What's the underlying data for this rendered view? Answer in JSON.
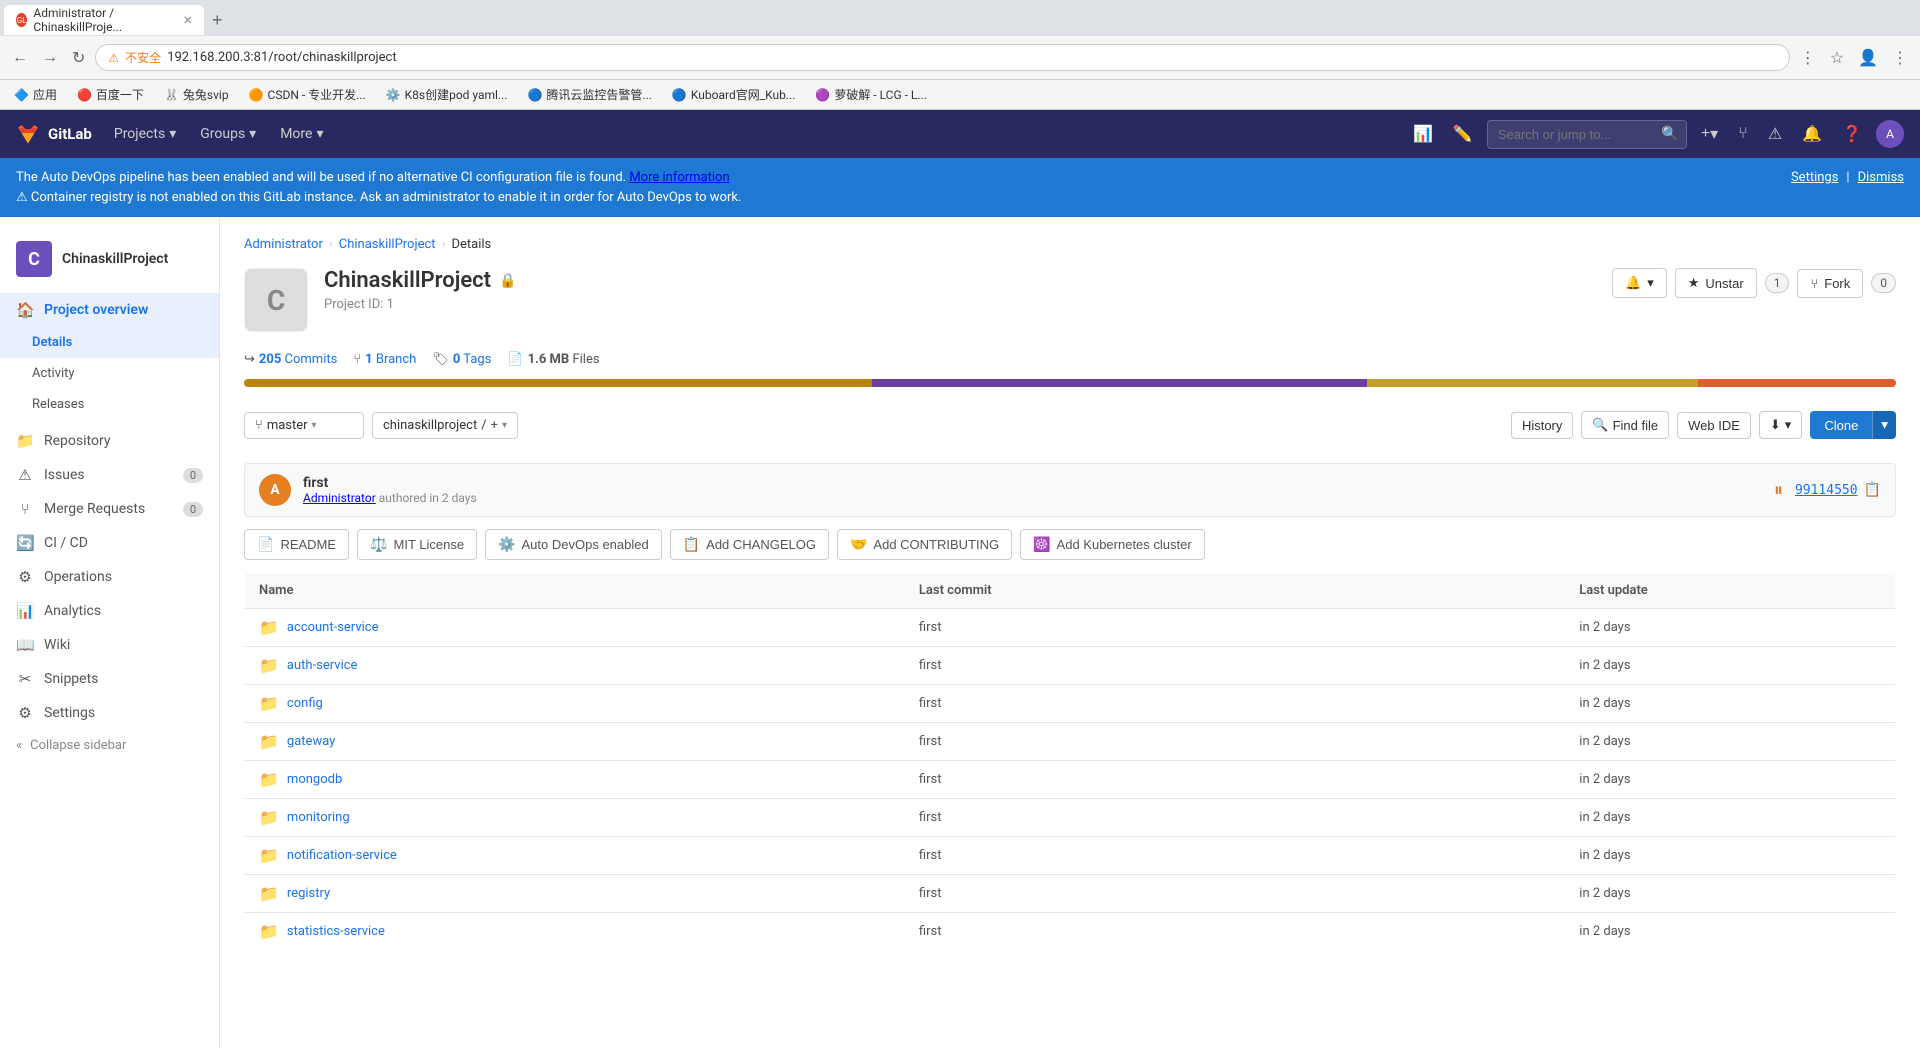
{
  "browser": {
    "tab_title": "Administrator / ChinaskillProje...",
    "tab_favicon": "GL",
    "new_tab": "+",
    "back": "←",
    "forward": "→",
    "refresh": "↻",
    "url": "192.168.200.3:81/root/chinaskillproject",
    "security_label": "不安全",
    "bookmarks": [
      {
        "label": "应用",
        "icon": "🔷"
      },
      {
        "label": "百度一下",
        "icon": "🔴"
      },
      {
        "label": "兔兔svip",
        "icon": "🐰"
      },
      {
        "label": "CSDN - 专业开发...",
        "icon": "🟠"
      },
      {
        "label": "K8s创建pod yaml...",
        "icon": "⚙️"
      },
      {
        "label": "腾讯云监控告警管...",
        "icon": "🔵"
      },
      {
        "label": "Kuboard官网_Kub...",
        "icon": "🔵"
      },
      {
        "label": "萝破解 - LCG - L...",
        "icon": "🟣"
      }
    ]
  },
  "gitlab": {
    "logo": "GitLab",
    "nav": {
      "projects_label": "Projects",
      "groups_label": "Groups",
      "more_label": "More",
      "search_placeholder": "Search or jump to...",
      "new_project_label": "+"
    },
    "alert": {
      "message": "The Auto DevOps pipeline has been enabled and will be used if no alternative CI configuration file is found.",
      "link_text": "More information",
      "message2": "⚠ Container registry is not enabled on this GitLab instance. Ask an administrator to enable it in order for Auto DevOps to work.",
      "settings_label": "Settings",
      "separator": "|",
      "dismiss_label": "Dismiss"
    },
    "sidebar": {
      "project_name": "ChinaskillProject",
      "project_avatar_letter": "C",
      "sections": [
        {
          "name": "project_overview",
          "icon": "🏠",
          "label": "Project overview",
          "active": true,
          "sub_items": [
            {
              "name": "details",
              "label": "Details",
              "active": true
            },
            {
              "name": "activity",
              "label": "Activity",
              "active": false
            },
            {
              "name": "releases",
              "label": "Releases",
              "active": false
            }
          ]
        },
        {
          "name": "repository",
          "icon": "📁",
          "label": "Repository",
          "badge": ""
        },
        {
          "name": "issues",
          "icon": "⚠",
          "label": "Issues",
          "badge": "0"
        },
        {
          "name": "merge_requests",
          "icon": "⑂",
          "label": "Merge Requests",
          "badge": "0"
        },
        {
          "name": "ci_cd",
          "icon": "🔄",
          "label": "CI / CD",
          "badge": ""
        },
        {
          "name": "operations",
          "icon": "⚙",
          "label": "Operations",
          "badge": ""
        },
        {
          "name": "analytics",
          "icon": "📊",
          "label": "Analytics",
          "badge": ""
        },
        {
          "name": "wiki",
          "icon": "📖",
          "label": "Wiki",
          "badge": ""
        },
        {
          "name": "snippets",
          "icon": "✂",
          "label": "Snippets",
          "badge": ""
        },
        {
          "name": "settings",
          "icon": "⚙",
          "label": "Settings",
          "badge": ""
        }
      ],
      "collapse_label": "Collapse sidebar"
    },
    "breadcrumb": [
      {
        "label": "Administrator",
        "link": true
      },
      {
        "label": "ChinaskillProject",
        "link": true
      },
      {
        "label": "Details",
        "link": false
      }
    ],
    "project": {
      "avatar_letter": "C",
      "name": "ChinaskillProject",
      "public_icon": "🔒",
      "project_id_label": "Project ID: 1",
      "stats": {
        "commits": "205",
        "commits_label": "Commits",
        "branches": "1",
        "branches_label": "Branch",
        "tags": "0",
        "tags_label": "Tags",
        "size": "1.6 MB",
        "files_label": "Files"
      },
      "actions": {
        "notification_label": "🔔",
        "unstar_label": "Unstar",
        "star_count": "1",
        "fork_label": "Fork",
        "fork_count": "0"
      }
    },
    "language_bar": [
      {
        "color": "#b8860b",
        "pct": 38
      },
      {
        "color": "#6b3fa0",
        "pct": 30
      },
      {
        "color": "#c5a028",
        "pct": 20
      },
      {
        "color": "#e05d2e",
        "pct": 12
      }
    ],
    "repo": {
      "branch": "master",
      "path": "chinaskillproject",
      "history_label": "History",
      "find_file_label": "Find file",
      "web_ide_label": "Web IDE",
      "download_icon": "⬇",
      "clone_label": "Clone",
      "commit": {
        "avatar_letter": "A",
        "message": "first",
        "author": "Administrator",
        "authored_time": "authored in 2 days",
        "status_icon": "⏸",
        "hash": "99114550",
        "copy_icon": "📋"
      },
      "quick_actions": [
        {
          "icon": "📄",
          "label": "README"
        },
        {
          "icon": "⚖️",
          "label": "MIT License"
        },
        {
          "icon": "⚙️",
          "label": "Auto DevOps enabled"
        },
        {
          "icon": "📋",
          "label": "Add CHANGELOG"
        },
        {
          "icon": "🤝",
          "label": "Add CONTRIBUTING"
        },
        {
          "icon": "☸️",
          "label": "Add Kubernetes cluster"
        }
      ],
      "file_table": {
        "headers": [
          "Name",
          "Last commit",
          "Last update"
        ],
        "rows": [
          {
            "name": "account-service",
            "type": "folder",
            "last_commit": "first",
            "last_update": "in 2 days"
          },
          {
            "name": "auth-service",
            "type": "folder",
            "last_commit": "first",
            "last_update": "in 2 days"
          },
          {
            "name": "config",
            "type": "folder",
            "last_commit": "first",
            "last_update": "in 2 days"
          },
          {
            "name": "gateway",
            "type": "folder",
            "last_commit": "first",
            "last_update": "in 2 days"
          },
          {
            "name": "mongodb",
            "type": "folder",
            "last_commit": "first",
            "last_update": "in 2 days"
          },
          {
            "name": "monitoring",
            "type": "folder",
            "last_commit": "first",
            "last_update": "in 2 days"
          },
          {
            "name": "notification-service",
            "type": "folder",
            "last_commit": "first",
            "last_update": "in 2 days"
          },
          {
            "name": "registry",
            "type": "folder",
            "last_commit": "first",
            "last_update": "in 2 days"
          },
          {
            "name": "statistics-service",
            "type": "folder",
            "last_commit": "first",
            "last_update": "in 2 days"
          }
        ]
      }
    }
  }
}
